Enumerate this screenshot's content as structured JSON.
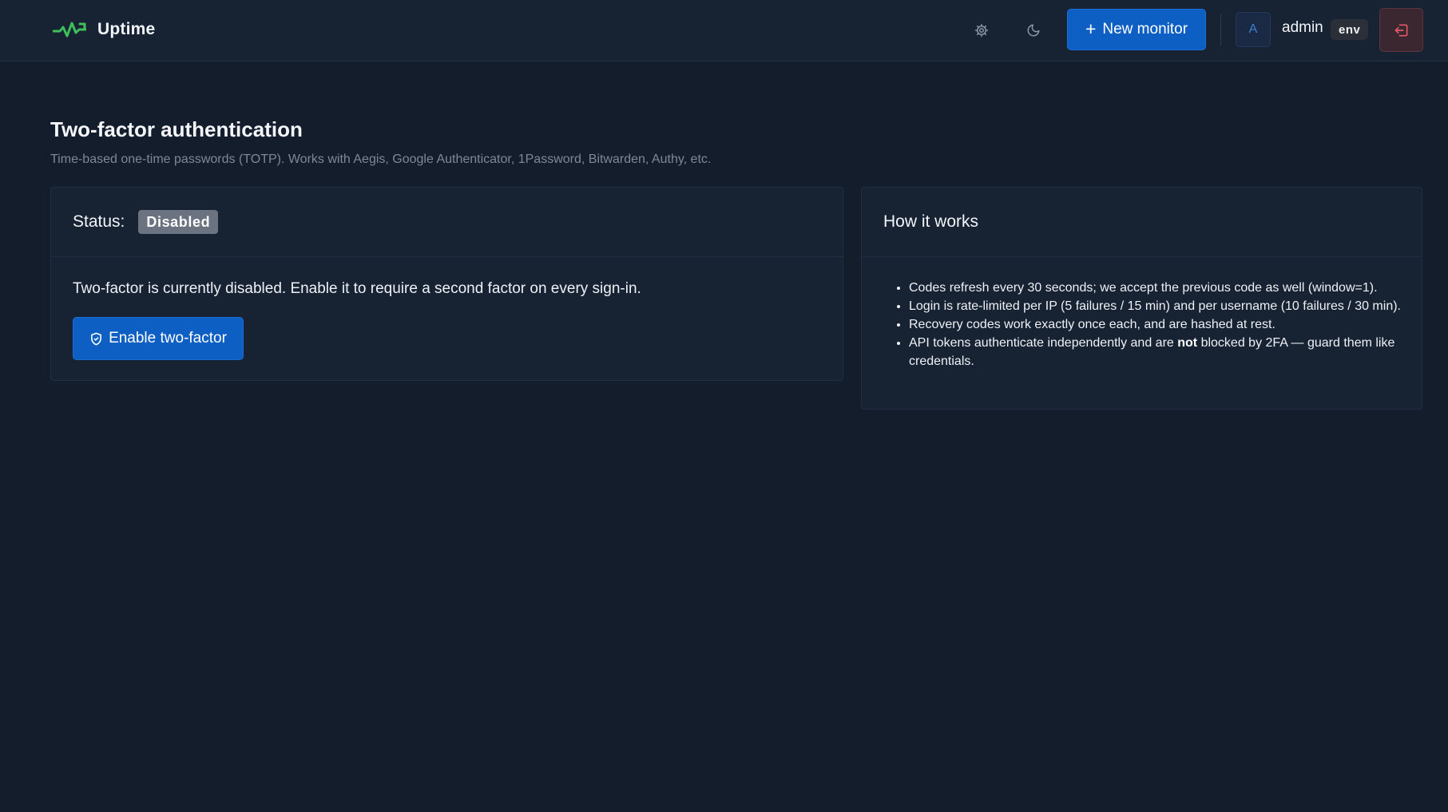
{
  "app": {
    "name": "Uptime",
    "logo_icon": "heartbeat-icon",
    "accent": "#0d5fc4",
    "logo_color": "#3fbf5a"
  },
  "navbar": {
    "settings_icon": "gear-icon",
    "theme_icon": "moon-icon",
    "new_monitor_label": "New monitor",
    "avatar_initial": "A",
    "username": "admin",
    "env_badge": "env",
    "logout_icon": "logout-icon"
  },
  "page": {
    "title": "Two-factor authentication",
    "subtitle": "Time-based one-time passwords (TOTP). Works with Aegis, Google Authenticator, 1Password, Bitwarden, Authy, etc."
  },
  "status_card": {
    "status_label": "Status:",
    "status_value": "Disabled",
    "description": "Two-factor is currently disabled. Enable it to require a second factor on every sign-in.",
    "enable_button_label": "Enable two-factor",
    "enable_button_icon": "shield-icon"
  },
  "how_card": {
    "title": "How it works",
    "items": [
      "Codes refresh every 30 seconds; we accept the previous code as well (window=1).",
      "Login is rate-limited per IP (5 failures / 15 min) and per username (10 failures / 30 min).",
      "Recovery codes work exactly once each, and are hashed at rest."
    ],
    "item4_before": "API tokens authenticate independently and are ",
    "item4_bold": "not",
    "item4_after": " blocked by 2FA — guard them like credentials."
  }
}
